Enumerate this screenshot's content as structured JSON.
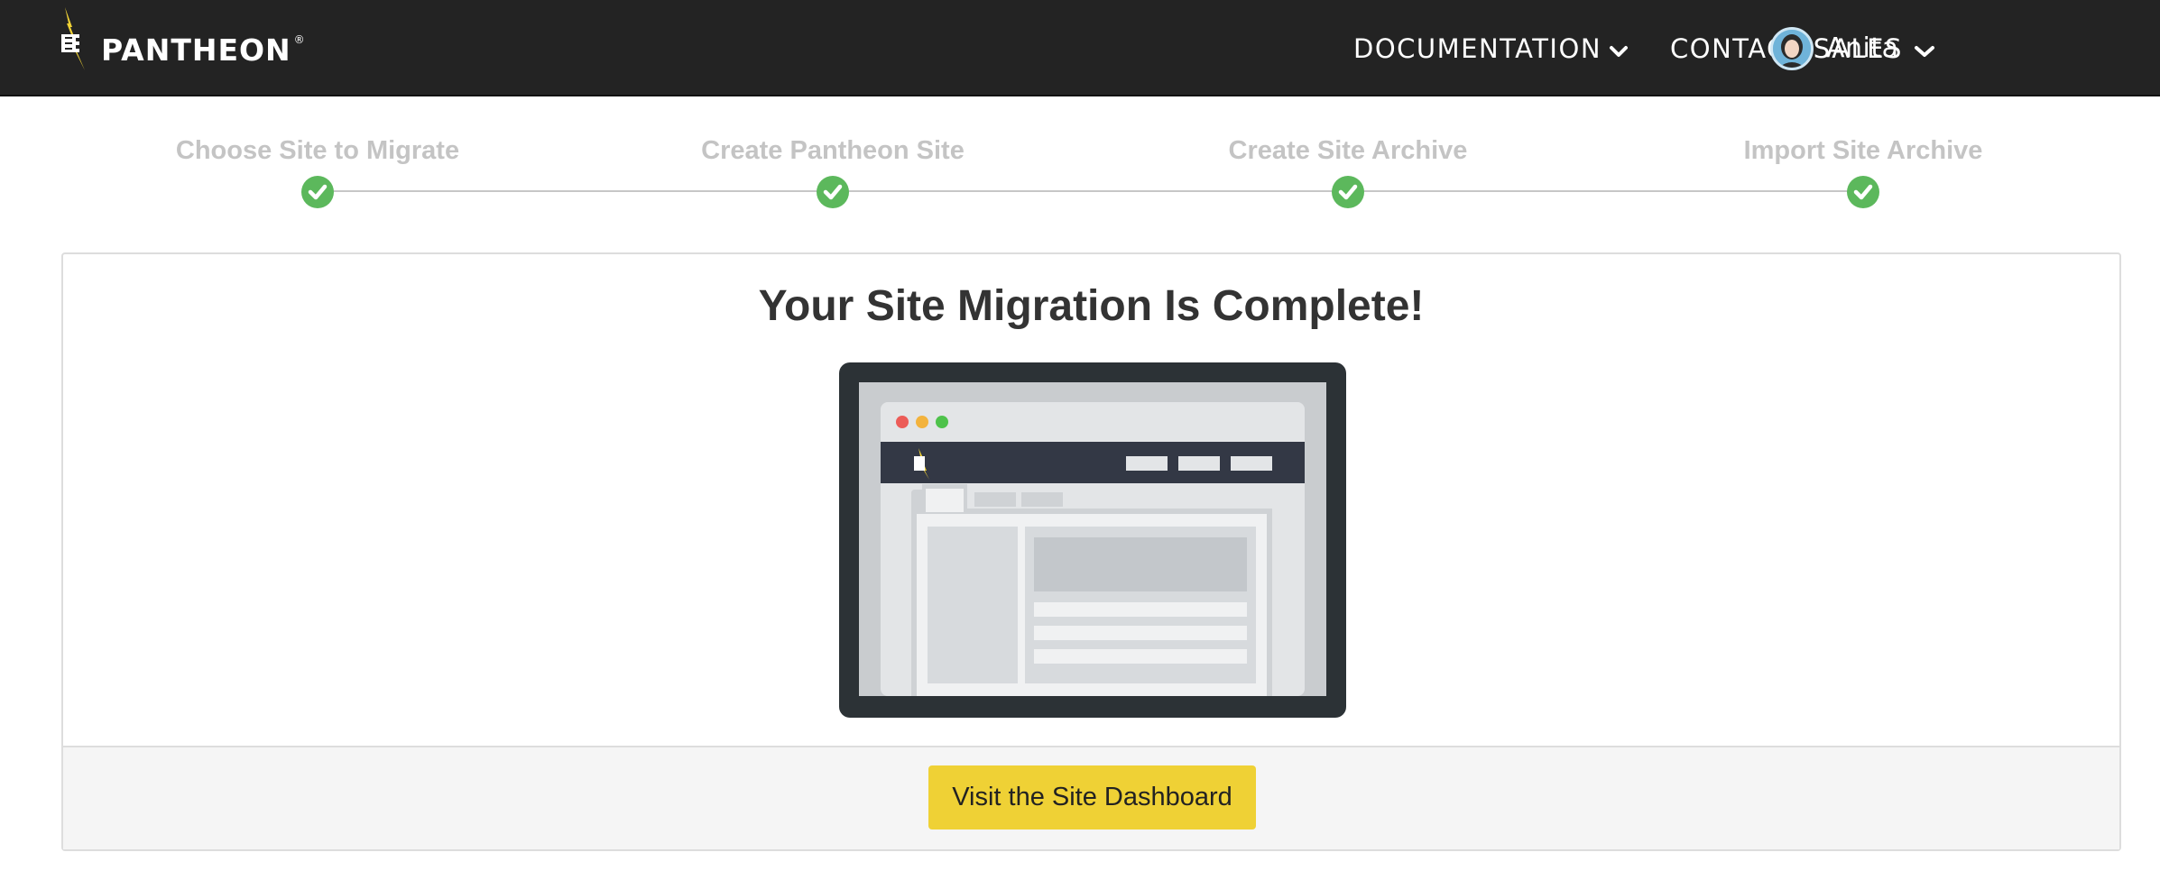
{
  "header": {
    "logo_text": "PANTHEON",
    "logo_mark": "®",
    "nav": {
      "documentation": "DOCUMENTATION",
      "contact_sales": "CONTACT SALES"
    },
    "user": {
      "name": "Anita"
    }
  },
  "stepper": {
    "steps": [
      {
        "label": "Choose Site to Migrate",
        "status": "complete"
      },
      {
        "label": "Create Pantheon Site",
        "status": "complete"
      },
      {
        "label": "Create Site Archive",
        "status": "complete"
      },
      {
        "label": "Import Site Archive",
        "status": "complete"
      }
    ],
    "complete_color": "#5cb85c"
  },
  "card": {
    "title": "Your Site Migration Is Complete!",
    "button_label": "Visit the Site Dashboard"
  },
  "colors": {
    "topbar": "#232323",
    "accent_yellow": "#efd135",
    "success_green": "#5cb85c"
  },
  "icons": {
    "logo": "pantheon-lightning-logo-icon",
    "dropdown": "chevron-down-icon",
    "check": "check-icon",
    "avatar": "user-avatar-icon"
  }
}
